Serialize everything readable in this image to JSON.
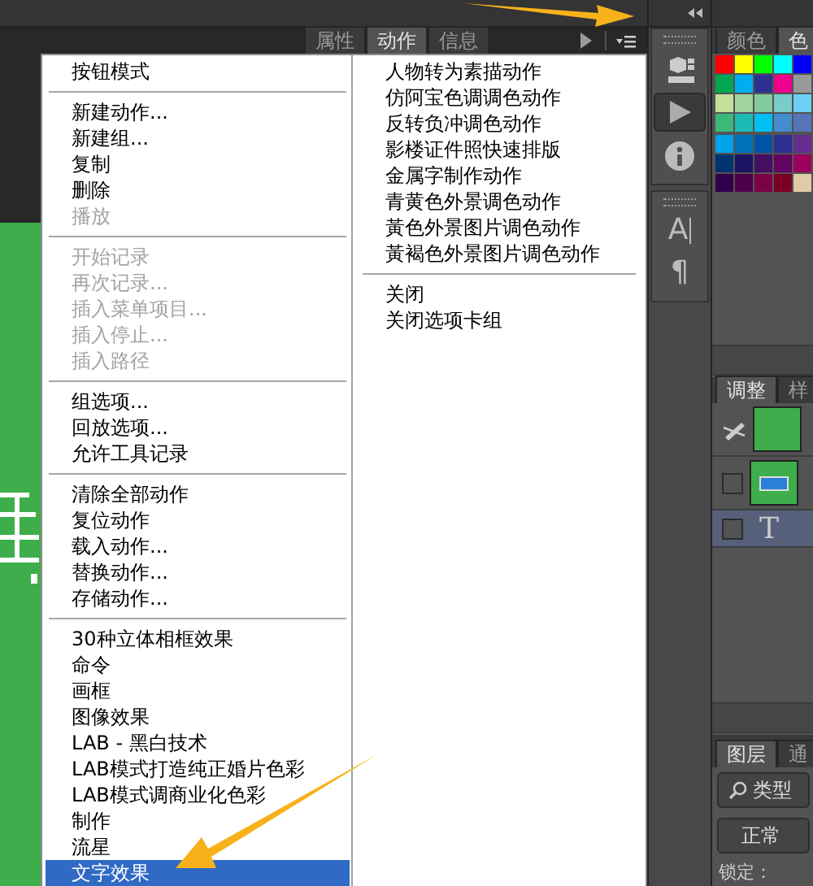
{
  "panel_tabs": [
    {
      "label": "属性",
      "selected": false
    },
    {
      "label": "动作",
      "selected": true
    },
    {
      "label": "信息",
      "selected": false
    }
  ],
  "menu": {
    "columns": [
      {
        "groups": [
          {
            "items": [
              {
                "label": "按钮模式",
                "disabled": false,
                "selected": false
              }
            ]
          },
          {
            "items": [
              {
                "label": "新建动作...",
                "disabled": false,
                "selected": false
              },
              {
                "label": "新建组...",
                "disabled": false,
                "selected": false
              },
              {
                "label": "复制",
                "disabled": false,
                "selected": false
              },
              {
                "label": "删除",
                "disabled": false,
                "selected": false
              },
              {
                "label": "播放",
                "disabled": true,
                "selected": false
              }
            ]
          },
          {
            "items": [
              {
                "label": "开始记录",
                "disabled": true,
                "selected": false
              },
              {
                "label": "再次记录...",
                "disabled": true,
                "selected": false
              },
              {
                "label": "插入菜单项目...",
                "disabled": true,
                "selected": false
              },
              {
                "label": "插入停止...",
                "disabled": true,
                "selected": false
              },
              {
                "label": "插入路径",
                "disabled": true,
                "selected": false
              }
            ]
          },
          {
            "items": [
              {
                "label": "组选项...",
                "disabled": false,
                "selected": false
              },
              {
                "label": "回放选项...",
                "disabled": false,
                "selected": false
              },
              {
                "label": "允许工具记录",
                "disabled": false,
                "selected": false
              }
            ]
          },
          {
            "items": [
              {
                "label": "清除全部动作",
                "disabled": false,
                "selected": false
              },
              {
                "label": "复位动作",
                "disabled": false,
                "selected": false
              },
              {
                "label": "载入动作...",
                "disabled": false,
                "selected": false
              },
              {
                "label": "替换动作...",
                "disabled": false,
                "selected": false
              },
              {
                "label": "存储动作...",
                "disabled": false,
                "selected": false
              }
            ]
          },
          {
            "items": [
              {
                "label": "30种立体相框效果",
                "disabled": false,
                "selected": false
              },
              {
                "label": "命令",
                "disabled": false,
                "selected": false
              },
              {
                "label": "画框",
                "disabled": false,
                "selected": false
              },
              {
                "label": "图像效果",
                "disabled": false,
                "selected": false
              },
              {
                "label": "LAB - 黑白技术",
                "disabled": false,
                "selected": false
              },
              {
                "label": "LAB模式打造纯正婚片色彩",
                "disabled": false,
                "selected": false
              },
              {
                "label": "LAB模式调商业化色彩",
                "disabled": false,
                "selected": false
              },
              {
                "label": "制作",
                "disabled": false,
                "selected": false
              },
              {
                "label": "流星",
                "disabled": false,
                "selected": false
              },
              {
                "label": "文字效果",
                "disabled": false,
                "selected": true
              }
            ]
          }
        ]
      },
      {
        "groups": [
          {
            "items": [
              {
                "label": "人物转为素描动作",
                "disabled": false,
                "selected": false
              },
              {
                "label": "仿阿宝色调调色动作",
                "disabled": false,
                "selected": false
              },
              {
                "label": "反转负冲调色动作",
                "disabled": false,
                "selected": false
              },
              {
                "label": "影楼证件照快速排版",
                "disabled": false,
                "selected": false
              },
              {
                "label": "金属字制作动作",
                "disabled": false,
                "selected": false
              },
              {
                "label": "青黄色外景调色动作",
                "disabled": false,
                "selected": false
              },
              {
                "label": "黃色外景图片调色动作",
                "disabled": false,
                "selected": false
              },
              {
                "label": "黃褐色外景图片调色动作",
                "disabled": false,
                "selected": false
              }
            ]
          },
          {
            "items": [
              {
                "label": "关闭",
                "disabled": false,
                "selected": false
              },
              {
                "label": "关闭选项卡组",
                "disabled": false,
                "selected": false
              }
            ]
          }
        ]
      }
    ]
  },
  "tool_buttons": [
    {
      "kind": "cube",
      "selected": false
    },
    {
      "kind": "play",
      "selected": true
    },
    {
      "kind": "info",
      "selected": false
    },
    {
      "kind": "glyph",
      "glyph": "A",
      "selected": false
    },
    {
      "kind": "glyph",
      "glyph": "¶",
      "selected": false
    }
  ],
  "color_tabs": [
    {
      "label": "颜色",
      "selected": false
    },
    {
      "label": "色",
      "selected": true
    }
  ],
  "swatches": [
    {
      "color": "#ff0000"
    },
    {
      "color": "#ffff00"
    },
    {
      "color": "#00ff00"
    },
    {
      "color": "#00ffff"
    },
    {
      "color": "#0000ff"
    },
    {
      "color": "#00a651"
    },
    {
      "color": "#00aeef"
    },
    {
      "color": "#2e3192"
    },
    {
      "color": "#ec008c"
    },
    {
      "color": "#999999"
    },
    {
      "color": "#c4df9b"
    },
    {
      "color": "#a3d39c"
    },
    {
      "color": "#82ca9c"
    },
    {
      "color": "#7accc8"
    },
    {
      "color": "#6dcff6"
    },
    {
      "color": "#3cb878"
    },
    {
      "color": "#1cbbb4"
    },
    {
      "color": "#00bff3"
    },
    {
      "color": "#448ccb"
    },
    {
      "color": "#5674b9"
    },
    {
      "color": "#00a2e8"
    },
    {
      "color": "#0072bc"
    },
    {
      "color": "#0054a6"
    },
    {
      "color": "#2e3192"
    },
    {
      "color": "#662d91"
    },
    {
      "color": "#003471"
    },
    {
      "color": "#1b1464"
    },
    {
      "color": "#440e62"
    },
    {
      "color": "#630460"
    },
    {
      "color": "#9e005d"
    },
    {
      "color": "#32004b"
    },
    {
      "color": "#4b0049"
    },
    {
      "color": "#7b0046"
    },
    {
      "color": "#7a0026"
    },
    {
      "color": "#e0cba8"
    }
  ],
  "adjust_tabs": [
    {
      "label": "调整",
      "selected": true
    },
    {
      "label": "样",
      "selected": false
    }
  ],
  "layers": [
    {
      "kind": "fill",
      "selected": false
    },
    {
      "kind": "shape",
      "selected": false
    },
    {
      "kind": "text",
      "glyph": "T",
      "selected": true
    }
  ],
  "layer_tabs": [
    {
      "label": "图层",
      "selected": true
    },
    {
      "label": "通",
      "selected": false
    }
  ],
  "filter": {
    "value": "类型"
  },
  "blend_mode": {
    "value": "正常"
  },
  "lock_label": "锁定："
}
